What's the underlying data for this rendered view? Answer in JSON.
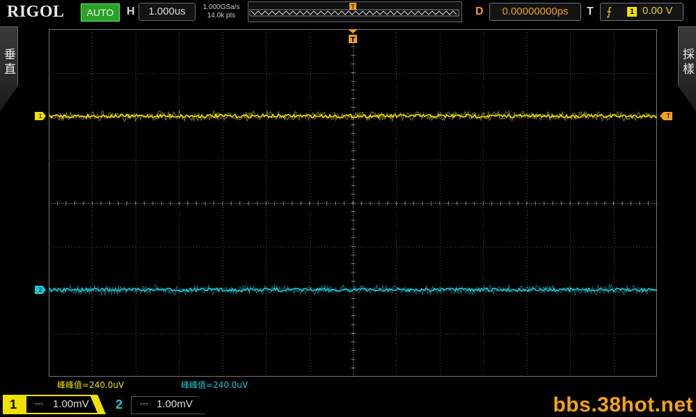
{
  "brand": "RIGOL",
  "status": {
    "run_mode": "AUTO"
  },
  "horizontal": {
    "label": "H",
    "timebase": "1.000us",
    "sample_rate": "1.000GSa/s",
    "memory_depth": "14.0k pts"
  },
  "delay": {
    "label": "D",
    "value": "0.00000000ps"
  },
  "trigger": {
    "label": "T",
    "edge_icon": "rising-edge-icon",
    "source": "1",
    "level": "0.00 V",
    "marker": "T"
  },
  "side_menus": {
    "left": "垂直",
    "right": "採樣"
  },
  "channels": [
    {
      "id": "1",
      "color": "#f0e000",
      "coupling": "⎓",
      "scale": "1.00mV",
      "marker": "1",
      "measurement": "峰峰值=240.0uV",
      "level": 0.25
    },
    {
      "id": "2",
      "color": "#19c8d8",
      "coupling": "⎓",
      "scale": "1.00mV",
      "marker": "2",
      "measurement": "峰峰值=240.0uV",
      "level": 0.75
    }
  ],
  "watermark": "bbs.38hot.net",
  "colors": {
    "trigger": "#f0a020",
    "grid": "#555555",
    "background": "#000000"
  }
}
